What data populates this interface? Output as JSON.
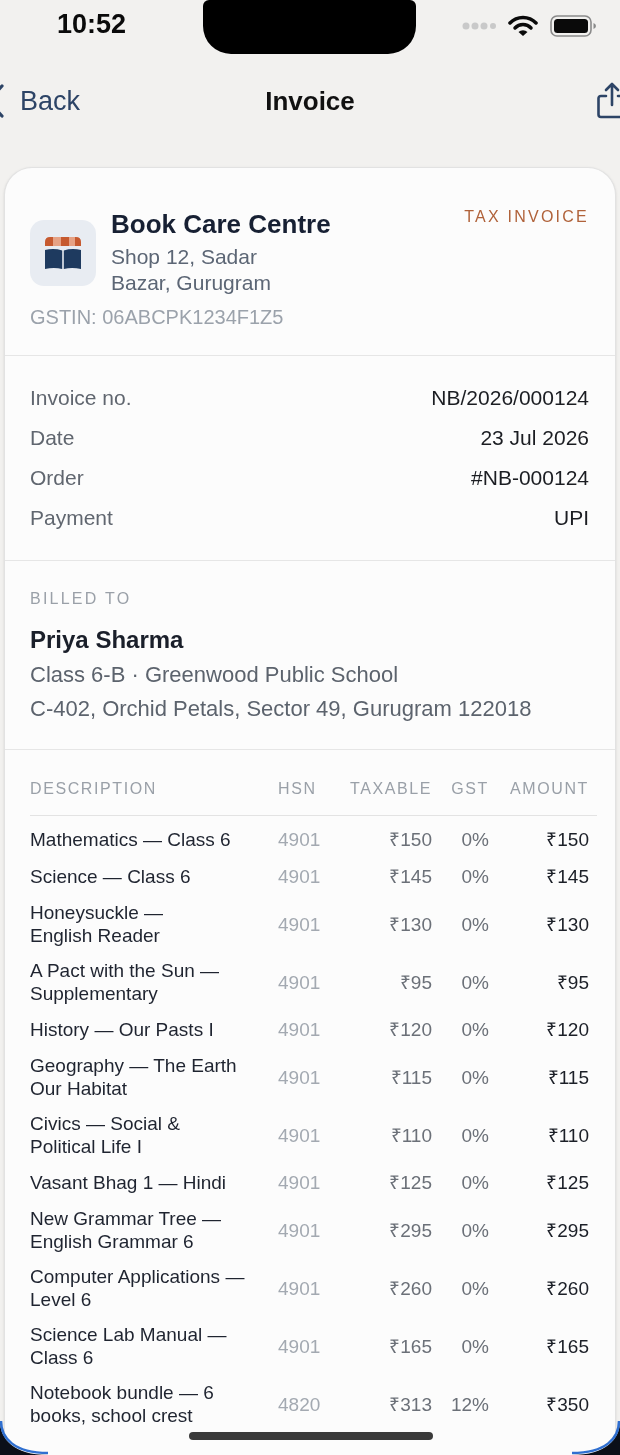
{
  "status_bar": {
    "time": "10:52"
  },
  "nav_bar": {
    "back_label": "Back",
    "title": "Invoice"
  },
  "seller": {
    "name": "Book Care Centre",
    "address": "Shop 12, Sadar Bazar, Gurugram",
    "gstin": "GSTIN: 06ABCPK1234F1Z5",
    "document_type": "TAX INVOICE"
  },
  "invoice_details": [
    {
      "label": "Invoice no.",
      "value": "NB/2026/000124"
    },
    {
      "label": "Date",
      "value": "23 Jul 2026"
    },
    {
      "label": "Order",
      "value": "#NB-000124"
    },
    {
      "label": "Payment",
      "value": "UPI"
    }
  ],
  "billed_to": {
    "heading": "BILLED TO",
    "name": "Priya Sharma",
    "lines": [
      "Class 6-B · Greenwood Public School",
      "C-402, Orchid Petals, Sector 49, Gurugram 122018"
    ]
  },
  "items_table": {
    "columns": [
      "DESCRIPTION",
      "HSN",
      "TAXABLE",
      "GST",
      "AMOUNT"
    ],
    "rows": [
      {
        "description": "Mathematics — Class 6",
        "hsn": "4901",
        "taxable": "₹150",
        "gst": "0%",
        "amount": "₹150"
      },
      {
        "description": "Science — Class 6",
        "hsn": "4901",
        "taxable": "₹145",
        "gst": "0%",
        "amount": "₹145"
      },
      {
        "description": "Honeysuckle —\nEnglish Reader",
        "hsn": "4901",
        "taxable": "₹130",
        "gst": "0%",
        "amount": "₹130"
      },
      {
        "description": "A Pact with the Sun —\nSupplementary",
        "hsn": "4901",
        "taxable": "₹95",
        "gst": "0%",
        "amount": "₹95"
      },
      {
        "description": "History — Our Pasts I",
        "hsn": "4901",
        "taxable": "₹120",
        "gst": "0%",
        "amount": "₹120"
      },
      {
        "description": "Geography — The Earth\nOur Habitat",
        "hsn": "4901",
        "taxable": "₹115",
        "gst": "0%",
        "amount": "₹115"
      },
      {
        "description": "Civics — Social &\nPolitical Life I",
        "hsn": "4901",
        "taxable": "₹110",
        "gst": "0%",
        "amount": "₹110"
      },
      {
        "description": "Vasant Bhag 1 — Hindi",
        "hsn": "4901",
        "taxable": "₹125",
        "gst": "0%",
        "amount": "₹125"
      },
      {
        "description": "New Grammar Tree —\nEnglish Grammar 6",
        "hsn": "4901",
        "taxable": "₹295",
        "gst": "0%",
        "amount": "₹295"
      },
      {
        "description": "Computer Applications —\nLevel 6",
        "hsn": "4901",
        "taxable": "₹260",
        "gst": "0%",
        "amount": "₹260"
      },
      {
        "description": "Science Lab Manual —\nClass 6",
        "hsn": "4901",
        "taxable": "₹165",
        "gst": "0%",
        "amount": "₹165"
      },
      {
        "description": "Notebook bundle — 6\nbooks, school crest",
        "hsn": "4820",
        "taxable": "₹313",
        "gst": "12%",
        "amount": "₹350"
      }
    ]
  }
}
